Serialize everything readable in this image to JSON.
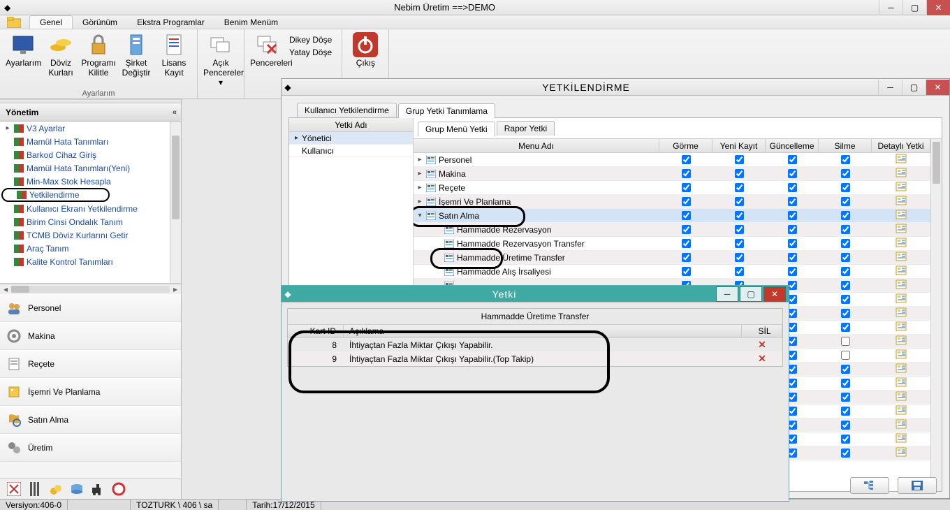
{
  "app": {
    "title": "Nebim Üretim  ==>DEMO"
  },
  "menu": {
    "items": [
      "Genel",
      "Görünüm",
      "Ekstra Programlar",
      "Benim Menüm"
    ],
    "selected": 0
  },
  "ribbon": {
    "group1": {
      "label": "Ayarlarım",
      "buttons": [
        {
          "label": "Ayarlarım",
          "icon": "screen"
        },
        {
          "label": "Döviz Kurları",
          "icon": "coins"
        },
        {
          "label": "Programı Kilitle",
          "icon": "lock"
        },
        {
          "label": "Şirket Değiştir",
          "icon": "server"
        },
        {
          "label": "Lisans Kayıt",
          "icon": "doc"
        }
      ]
    },
    "group2": {
      "buttons": [
        {
          "label": "Açık Pencereler ▾",
          "icon": "windows"
        }
      ]
    },
    "group3": {
      "buttons": [
        {
          "label": "Pencereleri",
          "icon": "windowsx"
        }
      ],
      "vmenu": [
        "Dikey Döşe",
        "Yatay Döşe"
      ]
    },
    "group4": {
      "buttons": [
        {
          "label": "Çıkış",
          "icon": "power"
        }
      ]
    }
  },
  "sidebar": {
    "header": "Yönetim",
    "nodes": [
      {
        "label": "V3 Ayarlar",
        "expander": "▸"
      },
      {
        "label": "Mamül Hata Tanımları"
      },
      {
        "label": "Barkod Cihaz Giriş"
      },
      {
        "label": "Mamül Hata Tanımları(Yeni)"
      },
      {
        "label": "Min-Max Stok Hesapla"
      },
      {
        "label": "Yetkilendirme",
        "circled": true
      },
      {
        "label": "Kullanıcı Ekranı Yetkilendirme"
      },
      {
        "label": "Birim Cinsi Ondalık Tanım"
      },
      {
        "label": "TCMB Döviz Kurlarını Getir"
      },
      {
        "label": "Araç Tanım"
      },
      {
        "label": "Kalite Kontrol Tanımları"
      }
    ],
    "groups": [
      {
        "label": "Personel"
      },
      {
        "label": "Makina"
      },
      {
        "label": "Reçete"
      },
      {
        "label": "İşemri Ve Planlama"
      },
      {
        "label": "Satın Alma"
      },
      {
        "label": "Üretim"
      }
    ]
  },
  "status": {
    "version": "Versiyon:406-0",
    "user": "TOZTURK \\ 406 \\ sa",
    "date": "Tarih:17/12/2015"
  },
  "yetk": {
    "title": "YETKİLENDİRME",
    "tabs": [
      "Kullanıcı Yetkilendirme",
      "Grup Yetki Tanımlama"
    ],
    "activeTab": 1,
    "leftHeader": "Yetki Adı",
    "leftRows": [
      "Yönetici",
      "Kullanıcı"
    ],
    "leftSelected": 0,
    "subtabs": [
      "Grup Menü Yetki",
      "Rapor Yetki"
    ],
    "activeSubtab": 0,
    "cols": [
      "Menu Adı",
      "Görme",
      "Yeni Kayıt",
      "Güncelleme",
      "Silme",
      "Detaylı Yetki"
    ],
    "rows": [
      {
        "label": "Personel",
        "lvl": 0,
        "exp": "▸",
        "g": true,
        "y": true,
        "gu": true,
        "s": true,
        "d": true
      },
      {
        "label": "Makina",
        "lvl": 0,
        "exp": "▸",
        "g": true,
        "y": true,
        "gu": true,
        "s": true,
        "d": true
      },
      {
        "label": "Reçete",
        "lvl": 0,
        "exp": "▸",
        "g": true,
        "y": true,
        "gu": true,
        "s": true,
        "d": true
      },
      {
        "label": "İşemri Ve Planlama",
        "lvl": 0,
        "exp": "▸",
        "g": true,
        "y": true,
        "gu": true,
        "s": true,
        "d": true
      },
      {
        "label": "Satın Alma",
        "lvl": 0,
        "exp": "▾",
        "g": true,
        "y": true,
        "gu": true,
        "s": true,
        "d": true,
        "circ": "A",
        "sel": true
      },
      {
        "label": "Hammadde Rezervasyon",
        "lvl": 1,
        "g": true,
        "y": true,
        "gu": true,
        "s": true,
        "d": true
      },
      {
        "label": "Hammadde Rezervasyon Transfer",
        "lvl": 1,
        "g": true,
        "y": true,
        "gu": true,
        "s": true,
        "d": true
      },
      {
        "label": "Hammadde Üretime Transfer",
        "lvl": 1,
        "g": true,
        "y": true,
        "gu": true,
        "s": true,
        "d": true,
        "circ": "B",
        "detcirc": true
      },
      {
        "label": "Hammadde Alış İrsaliyesi",
        "lvl": 1,
        "g": true,
        "y": true,
        "gu": true,
        "s": true,
        "d": true
      },
      {
        "label": "",
        "lvl": 1,
        "g": true,
        "y": true,
        "gu": true,
        "s": true,
        "d": true
      },
      {
        "label": "",
        "lvl": 1,
        "g": true,
        "y": true,
        "gu": true,
        "s": true,
        "d": true
      },
      {
        "label": "",
        "lvl": 1,
        "g": true,
        "y": true,
        "gu": true,
        "s": true,
        "d": true
      },
      {
        "label": "",
        "lvl": 1,
        "g": true,
        "y": true,
        "gu": true,
        "s": true,
        "d": true
      },
      {
        "label": "",
        "lvl": 1,
        "g": true,
        "y": true,
        "gu": true,
        "s": false,
        "d": true
      },
      {
        "label": "",
        "lvl": 1,
        "g": true,
        "y": true,
        "gu": true,
        "s": false,
        "d": true
      },
      {
        "label": "",
        "lvl": 1,
        "g": true,
        "y": true,
        "gu": true,
        "s": true,
        "d": true
      },
      {
        "label": "",
        "lvl": 1,
        "g": true,
        "y": true,
        "gu": true,
        "s": true,
        "d": true
      },
      {
        "label": "",
        "lvl": 1,
        "g": true,
        "y": true,
        "gu": true,
        "s": true,
        "d": true
      },
      {
        "label": "",
        "lvl": 1,
        "g": true,
        "y": true,
        "gu": true,
        "s": true,
        "d": true
      },
      {
        "label": "",
        "lvl": 1,
        "g": true,
        "y": true,
        "gu": true,
        "s": true,
        "d": true
      },
      {
        "label": "",
        "lvl": 1,
        "g": true,
        "y": true,
        "gu": true,
        "s": true,
        "d": true
      },
      {
        "label": "",
        "lvl": 1,
        "g": true,
        "y": true,
        "gu": true,
        "s": true,
        "d": true
      }
    ]
  },
  "popup": {
    "title": "Yetki",
    "subtitle": "Hammadde Üretime Transfer",
    "cols": [
      "Kart ID",
      "Açıklama",
      "SİL"
    ],
    "rows": [
      {
        "id": "8",
        "ac": "İhtiyaçtan Fazla Miktar Çıkışı Yapabilir."
      },
      {
        "id": "9",
        "ac": "İhtiyaçtan Fazla Miktar Çıkışı Yapabilir.(Top Takip)"
      }
    ]
  }
}
